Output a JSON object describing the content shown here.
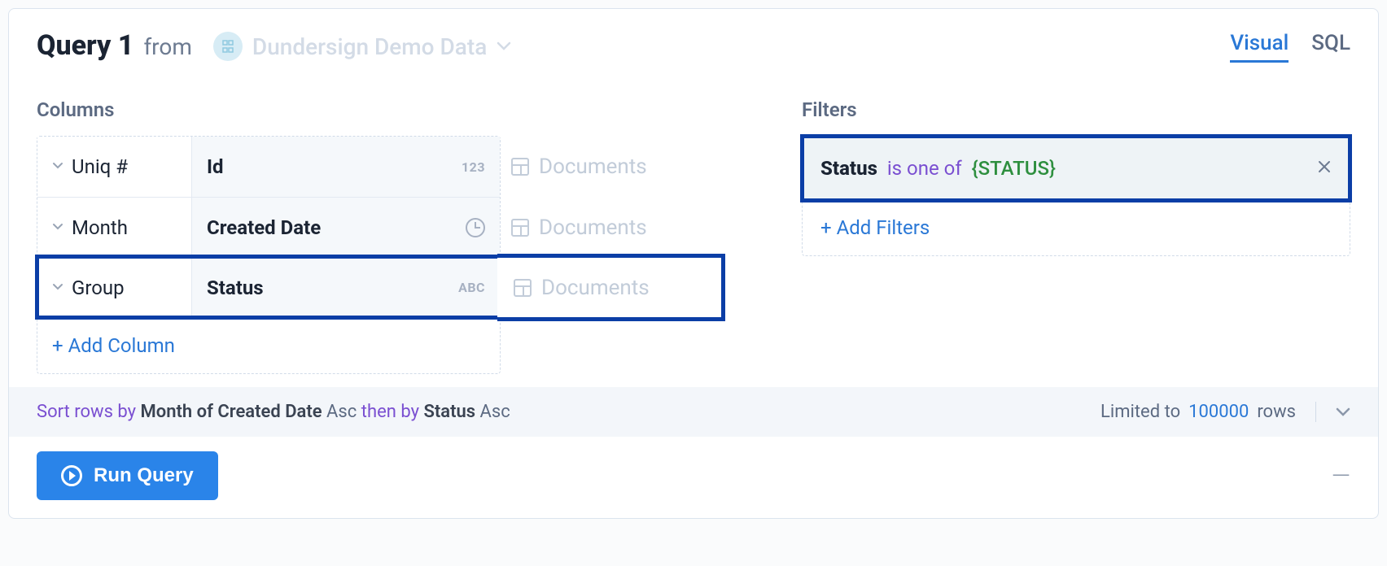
{
  "header": {
    "title": "Query 1",
    "from_label": "from",
    "source_name": "Dundersign Demo Data"
  },
  "tabs": {
    "visual": "Visual",
    "sql": "SQL"
  },
  "columns": {
    "label": "Columns",
    "rows": [
      {
        "agg": "Uniq #",
        "field": "Id",
        "type": "123",
        "table": "Documents"
      },
      {
        "agg": "Month",
        "field": "Created Date",
        "type": "clock",
        "table": "Documents"
      },
      {
        "agg": "Group",
        "field": "Status",
        "type": "ABC",
        "table": "Documents"
      }
    ],
    "add_label": "+ Add Column"
  },
  "filters": {
    "label": "Filters",
    "row": {
      "field": "Status",
      "op": "is one of",
      "value": "{STATUS}"
    },
    "add_label": "+ Add Filters"
  },
  "sort": {
    "intro": "Sort rows by",
    "field1": "Month of Created Date",
    "dir1": "Asc",
    "then": "then by",
    "field2": "Status",
    "dir2": "Asc",
    "limit_label": "Limited to",
    "limit_value": "100000",
    "limit_suffix": "rows"
  },
  "footer": {
    "run_label": "Run Query"
  }
}
